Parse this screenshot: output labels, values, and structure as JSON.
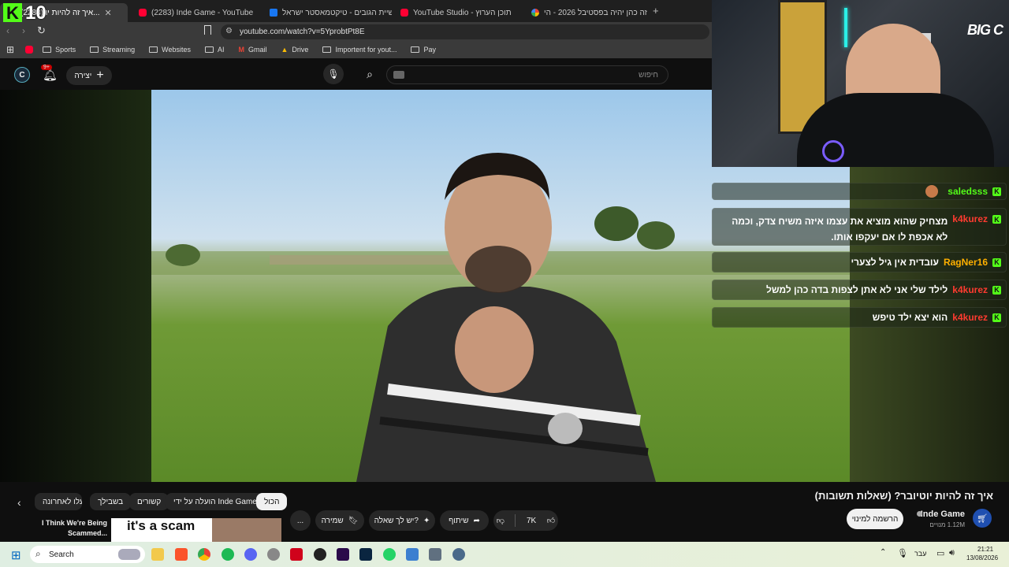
{
  "browser": {
    "tabs": [
      {
        "title": "(2283) איך זה להיות יו...",
        "favicon": "youtube",
        "active": true
      },
      {
        "title": "(2283) Inde Game - YouTube",
        "favicon": "youtube"
      },
      {
        "title": "שלישיית הגובים - טיקטמאסטר ישראל",
        "favicon": "facebook"
      },
      {
        "title": "YouTube Studio - תוכן הערוץ",
        "favicon": "youtube"
      },
      {
        "title": "האם זה כהן יהיה בפסטיבל 2026 - הי...",
        "favicon": "google"
      }
    ],
    "new_tab": "+",
    "url": "youtube.com/watch?v=5YprobtPt8E",
    "bookmarks": [
      "Sports",
      "Streaming",
      "Websites",
      "AI",
      "Gmail",
      "Drive",
      "Importent for yout...",
      "Pay"
    ]
  },
  "kick_overlay": {
    "count": "10"
  },
  "youtube": {
    "search_placeholder": "חיפוש",
    "create_label": "יצירה",
    "notifications_count": "9+",
    "video_title": "איך זה להיות יוטיובר? (שאלות תשובות)",
    "channel_name": "Inde Game",
    "subscribers": "1.12M מנויים",
    "subscribe_label": "הרשמה למינוי",
    "likes": "7K",
    "share_label": "שיתוף",
    "ask_label": "יש לך שאלה?",
    "save_label": "שמירה",
    "more_label": "...",
    "chips": [
      "הכול",
      "הועלה על ידי Inde Game",
      "קשורים",
      "בשבילך",
      "הועלו לאחרונה"
    ],
    "next_video_title": "I Think We're Being Scammed...",
    "next_video_thumb_text": "it's a scam"
  },
  "stream_overlay": {
    "brand": "BIG C"
  },
  "chat": [
    {
      "user": "saledsss",
      "user_color": "#53fc18",
      "message": "",
      "emote": true
    },
    {
      "user": "k4kurez",
      "user_color": "#ff3b30",
      "message": "מצחיק שהוא מוציא את עצמו איזה משיח צדק, וכמה לא אכפת לו אם יעקפו אותו."
    },
    {
      "user": "RagNer16",
      "user_color": "#ffb000",
      "message": "עובדית אין גיל לצערי"
    },
    {
      "user": "k4kurez",
      "user_color": "#ff3b30",
      "message": "לילד שלי אני לא אתן לצפות בדה כהן למשל"
    },
    {
      "user": "k4kurez",
      "user_color": "#ff3b30",
      "message": "הוא יצא ילד טיפש"
    }
  ],
  "taskbar": {
    "search_label": "Search",
    "language": "עבר",
    "time": "21:21",
    "date": "13/08/2026"
  }
}
